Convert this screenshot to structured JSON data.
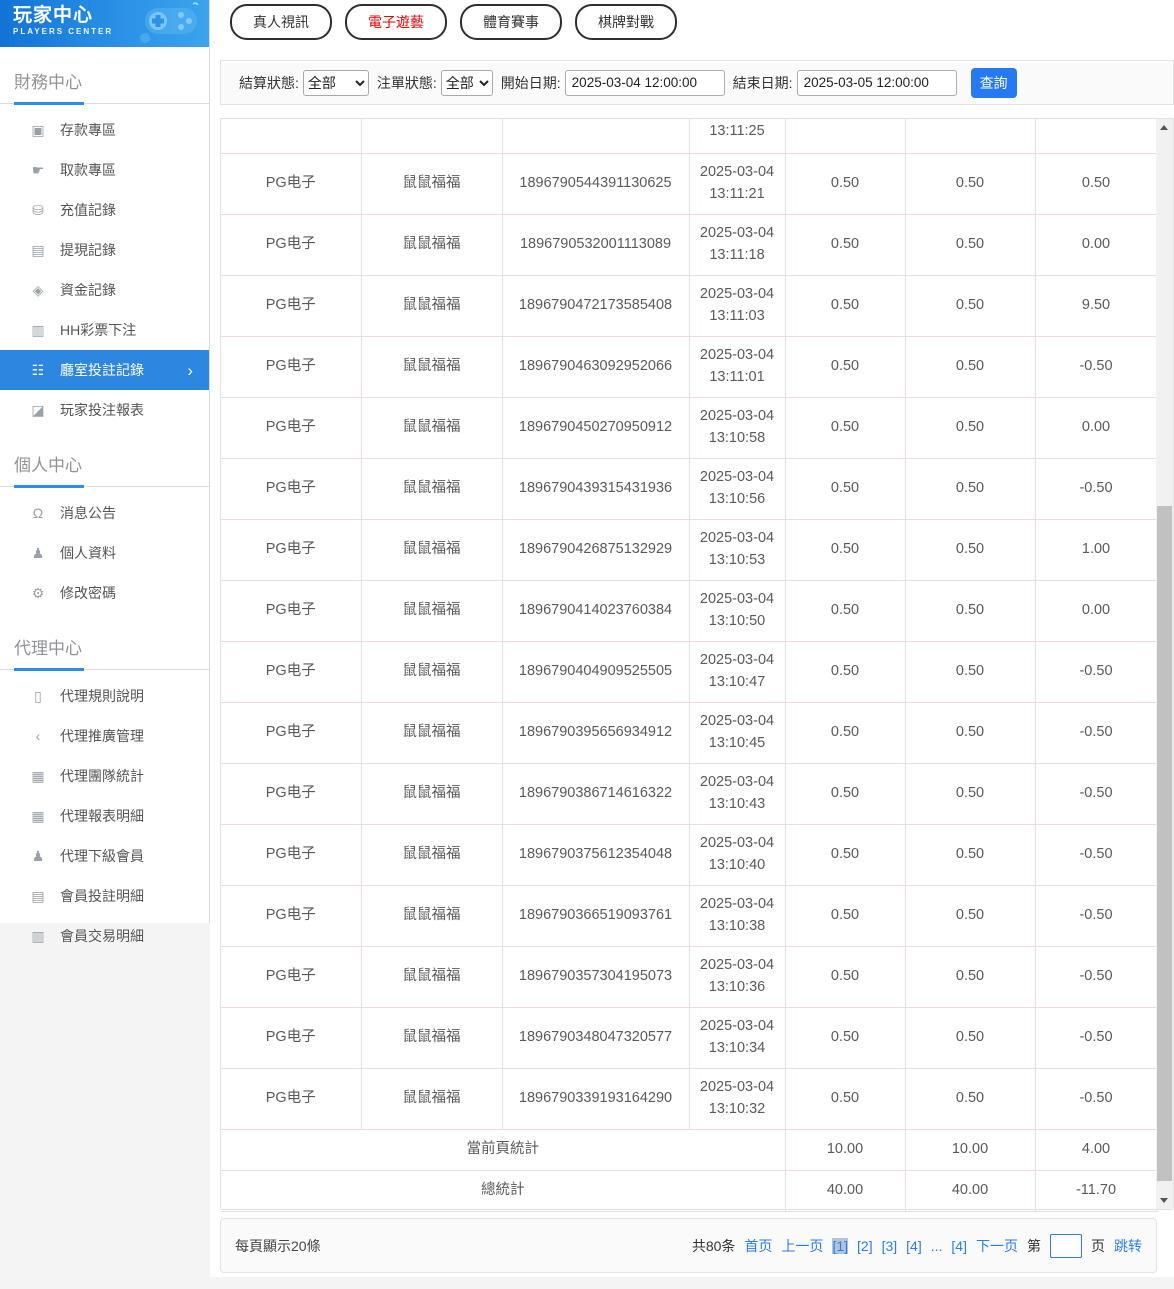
{
  "app": {
    "title": "玩家中心",
    "subtitle": "PLAYERS CENTER"
  },
  "colors": {
    "accent_blue": "#2d86e0",
    "query_blue": "#2679f2",
    "link_blue": "#2a7cf0",
    "tab_active_red": "#e80000",
    "table_border_pink": "#f0dcdc",
    "sidebar_icon_gray": "#98a0a8"
  },
  "icon_glyphs": {
    "deposit-card-icon": "▣",
    "withdraw-hand-icon": "☛",
    "recharge-bag-icon": "⛁",
    "cash-record-icon": "▤",
    "funds-record-icon": "◈",
    "lottery-list-icon": "▥",
    "room-bets-icon": "☷",
    "report-chart-icon": "◪",
    "bell-icon": "Ω",
    "user-icon": "♟",
    "gear-icon": "⚙",
    "doc-icon": "▯",
    "share-icon": "‹",
    "news-icon": "▦",
    "users-icon": "♟",
    "clipboard-icon": "▤",
    "transactions-icon": "▥"
  },
  "sidebar": {
    "sections": [
      {
        "label": "財務中心",
        "items": [
          {
            "id": "deposit",
            "icon": "deposit-card-icon",
            "label": "存款專區",
            "active": false
          },
          {
            "id": "withdraw",
            "icon": "withdraw-hand-icon",
            "label": "取款專區",
            "active": false
          },
          {
            "id": "recharge-records",
            "icon": "recharge-bag-icon",
            "label": "充值記錄",
            "active": false
          },
          {
            "id": "withdrawal-records",
            "icon": "cash-record-icon",
            "label": "提現記錄",
            "active": false
          },
          {
            "id": "funds-records",
            "icon": "funds-record-icon",
            "label": "資金記錄",
            "active": false
          },
          {
            "id": "hh-lottery-bets",
            "icon": "lottery-list-icon",
            "label": "HH彩票下注",
            "active": false
          },
          {
            "id": "room-bet-records",
            "icon": "room-bets-icon",
            "label": "廳室投註記錄",
            "active": true
          },
          {
            "id": "player-bet-report",
            "icon": "report-chart-icon",
            "label": "玩家投注報表",
            "active": false
          }
        ]
      },
      {
        "label": "個人中心",
        "items": [
          {
            "id": "announcements",
            "icon": "bell-icon",
            "label": "消息公告",
            "active": false
          },
          {
            "id": "profile",
            "icon": "user-icon",
            "label": "個人資料",
            "active": false
          },
          {
            "id": "change-password",
            "icon": "gear-icon",
            "label": "修改密碼",
            "active": false
          }
        ]
      },
      {
        "label": "代理中心",
        "items": [
          {
            "id": "agent-rules",
            "icon": "doc-icon",
            "label": "代理規則說明",
            "active": false
          },
          {
            "id": "agent-promotion",
            "icon": "share-icon",
            "label": "代理推廣管理",
            "active": false
          },
          {
            "id": "agent-team-stats",
            "icon": "news-icon",
            "label": "代理團隊統計",
            "active": false
          },
          {
            "id": "agent-report-details",
            "icon": "news-icon",
            "label": "代理報表明細",
            "active": false
          },
          {
            "id": "agent-sub-members",
            "icon": "users-icon",
            "label": "代理下級會員",
            "active": false
          },
          {
            "id": "member-bet-details",
            "icon": "clipboard-icon",
            "label": "會員投註明細",
            "active": false
          },
          {
            "id": "member-transaction-details",
            "icon": "transactions-icon",
            "label": "會員交易明細",
            "active": false
          }
        ]
      }
    ]
  },
  "tabs": [
    {
      "id": "live-video",
      "label": "真人視訊",
      "active": false
    },
    {
      "id": "electronic-games",
      "label": "電子遊藝",
      "active": true
    },
    {
      "id": "sports-events",
      "label": "體育賽事",
      "active": false
    },
    {
      "id": "board-card-battle",
      "label": "棋牌對戰",
      "active": false
    }
  ],
  "filters": {
    "settle_status_label": "結算狀態:",
    "settle_status_value": "全部",
    "bet_status_label": "注單狀態:",
    "bet_status_value": "全部",
    "start_date_label": "開始日期:",
    "start_date_value": "2025-03-04 12:00:00",
    "end_date_label": "結束日期:",
    "end_date_value": "2025-03-05 12:00:00",
    "query_label": "查詢"
  },
  "table": {
    "partial_top_row": {
      "time": "13:11:25"
    },
    "rows": [
      [
        "PG电子",
        "鼠鼠福福",
        "1896790544391130625",
        "2025-03-04",
        "13:11:21",
        "0.50",
        "0.50",
        "0.50"
      ],
      [
        "PG电子",
        "鼠鼠福福",
        "1896790532001113089",
        "2025-03-04",
        "13:11:18",
        "0.50",
        "0.50",
        "0.00"
      ],
      [
        "PG电子",
        "鼠鼠福福",
        "1896790472173585408",
        "2025-03-04",
        "13:11:03",
        "0.50",
        "0.50",
        "9.50"
      ],
      [
        "PG电子",
        "鼠鼠福福",
        "1896790463092952066",
        "2025-03-04",
        "13:11:01",
        "0.50",
        "0.50",
        "-0.50"
      ],
      [
        "PG电子",
        "鼠鼠福福",
        "1896790450270950912",
        "2025-03-04",
        "13:10:58",
        "0.50",
        "0.50",
        "0.00"
      ],
      [
        "PG电子",
        "鼠鼠福福",
        "1896790439315431936",
        "2025-03-04",
        "13:10:56",
        "0.50",
        "0.50",
        "-0.50"
      ],
      [
        "PG电子",
        "鼠鼠福福",
        "1896790426875132929",
        "2025-03-04",
        "13:10:53",
        "0.50",
        "0.50",
        "1.00"
      ],
      [
        "PG电子",
        "鼠鼠福福",
        "1896790414023760384",
        "2025-03-04",
        "13:10:50",
        "0.50",
        "0.50",
        "0.00"
      ],
      [
        "PG电子",
        "鼠鼠福福",
        "1896790404909525505",
        "2025-03-04",
        "13:10:47",
        "0.50",
        "0.50",
        "-0.50"
      ],
      [
        "PG电子",
        "鼠鼠福福",
        "1896790395656934912",
        "2025-03-04",
        "13:10:45",
        "0.50",
        "0.50",
        "-0.50"
      ],
      [
        "PG电子",
        "鼠鼠福福",
        "1896790386714616322",
        "2025-03-04",
        "13:10:43",
        "0.50",
        "0.50",
        "-0.50"
      ],
      [
        "PG电子",
        "鼠鼠福福",
        "1896790375612354048",
        "2025-03-04",
        "13:10:40",
        "0.50",
        "0.50",
        "-0.50"
      ],
      [
        "PG电子",
        "鼠鼠福福",
        "1896790366519093761",
        "2025-03-04",
        "13:10:38",
        "0.50",
        "0.50",
        "-0.50"
      ],
      [
        "PG电子",
        "鼠鼠福福",
        "1896790357304195073",
        "2025-03-04",
        "13:10:36",
        "0.50",
        "0.50",
        "-0.50"
      ],
      [
        "PG电子",
        "鼠鼠福福",
        "1896790348047320577",
        "2025-03-04",
        "13:10:34",
        "0.50",
        "0.50",
        "-0.50"
      ],
      [
        "PG电子",
        "鼠鼠福福",
        "1896790339193164290",
        "2025-03-04",
        "13:10:32",
        "0.50",
        "0.50",
        "-0.50"
      ]
    ],
    "summary_rows": [
      {
        "label": "當前頁統計",
        "values": [
          "10.00",
          "10.00",
          "4.00"
        ]
      },
      {
        "label": "總統計",
        "values": [
          "40.00",
          "40.00",
          "-11.70"
        ]
      }
    ]
  },
  "pagination": {
    "per_page": "每頁顯示20條",
    "total": "共80条",
    "first": "首页",
    "prev": "上一页",
    "pages": [
      {
        "label": "[1]",
        "current": true
      },
      {
        "label": "[2]",
        "current": false
      },
      {
        "label": "[3]",
        "current": false
      },
      {
        "label": "[4]",
        "current": false
      },
      {
        "label": "...",
        "ellipsis": true
      },
      {
        "label": "[4]",
        "current": false
      }
    ],
    "next": "下一页",
    "jump_prefix": "第",
    "jump_suffix": "页",
    "jump_action": "跳转"
  }
}
